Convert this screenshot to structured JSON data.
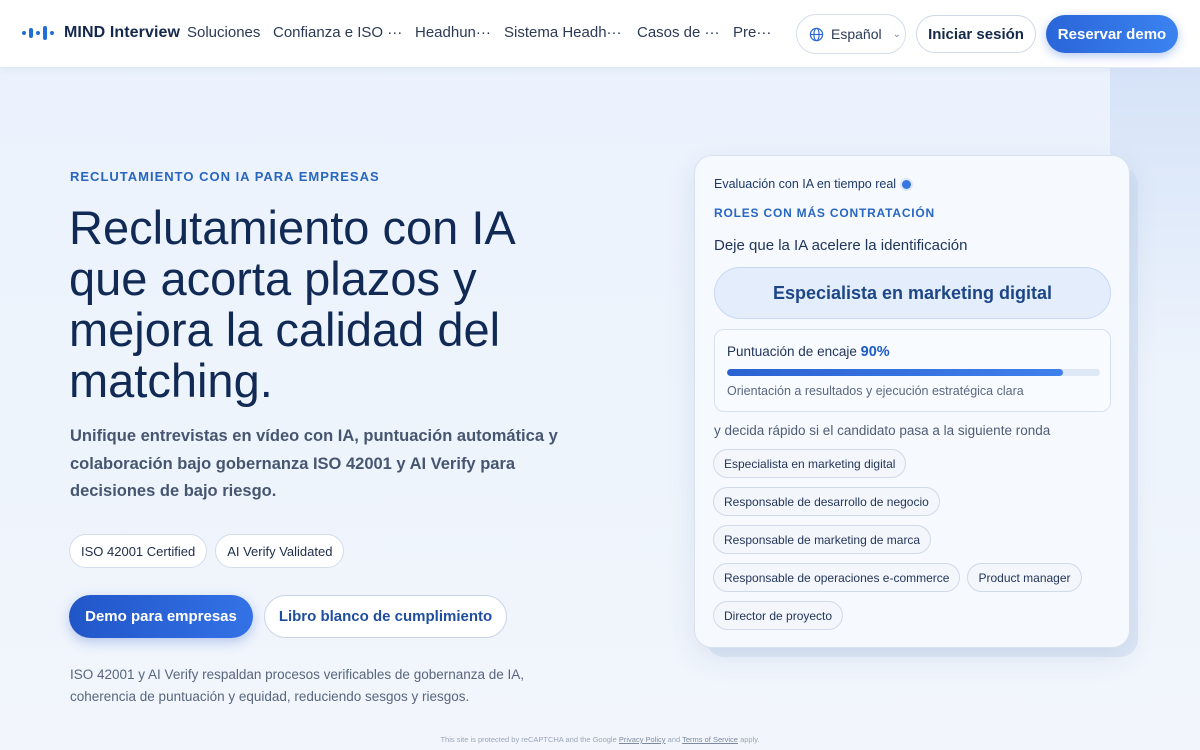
{
  "header": {
    "logo_text": "MIND Interview",
    "nav": [
      {
        "label": "Soluciones",
        "width": 86
      },
      {
        "label": "Confianza e ISO ···",
        "width": 142
      },
      {
        "label": "Headhun···",
        "width": 89
      },
      {
        "label": "Sistema Headh···",
        "width": 133
      },
      {
        "label": "Casos de ···",
        "width": 96
      },
      {
        "label": "Pre···",
        "width": 50
      }
    ],
    "language": "Español",
    "login_label": "Iniciar sesión",
    "demo_label": "Reservar demo"
  },
  "hero": {
    "eyebrow": "RECLUTAMIENTO CON IA PARA EMPRESAS",
    "title": "Reclutamiento con IA que acorta plazos y mejora la calidad del matching.",
    "subtitle": "Unifique entrevistas en vídeo con IA, puntuación automática y colaboración bajo gobernanza ISO 42001 y AI Verify para decisiones de bajo riesgo.",
    "badges": [
      "ISO 42001 Certified",
      "AI Verify Validated"
    ],
    "cta_primary": "Demo para empresas",
    "cta_secondary": "Libro blanco de cumplimiento",
    "footnote": "ISO 42001 y AI Verify respaldan procesos verificables de gobernanza de IA, coherencia de puntuación y equidad, reduciendo sesgos y riesgos."
  },
  "card": {
    "live_label": "Evaluación con IA en tiempo real",
    "eyebrow": "ROLES CON MÁS CONTRATACIÓN",
    "prompt": "Deje que la IA acelere la identificación",
    "highlight_role": "Especialista en marketing digital",
    "score_label": "Puntuación de encaje",
    "score_value": "90%",
    "score_fraction": 0.9,
    "score_note": "Orientación a resultados y ejecución estratégica clara",
    "tail": "y decida rápido si el candidato pasa a la siguiente ronda",
    "chips": [
      "Especialista en marketing digital",
      "Responsable de desarrollo de negocio",
      "Responsable de marketing de marca",
      "Responsable de operaciones e-commerce",
      "Product manager",
      "Director de proyecto"
    ]
  },
  "recaptcha": {
    "prefix": "This site is protected by reCAPTCHA and the Google",
    "privacy": "Privacy Policy",
    "and": "and",
    "terms": "Terms of Service",
    "suffix": "apply."
  },
  "colors": {
    "accent": "#2a66d9",
    "title": "#112a55",
    "eyebrow": "#2866c0"
  }
}
